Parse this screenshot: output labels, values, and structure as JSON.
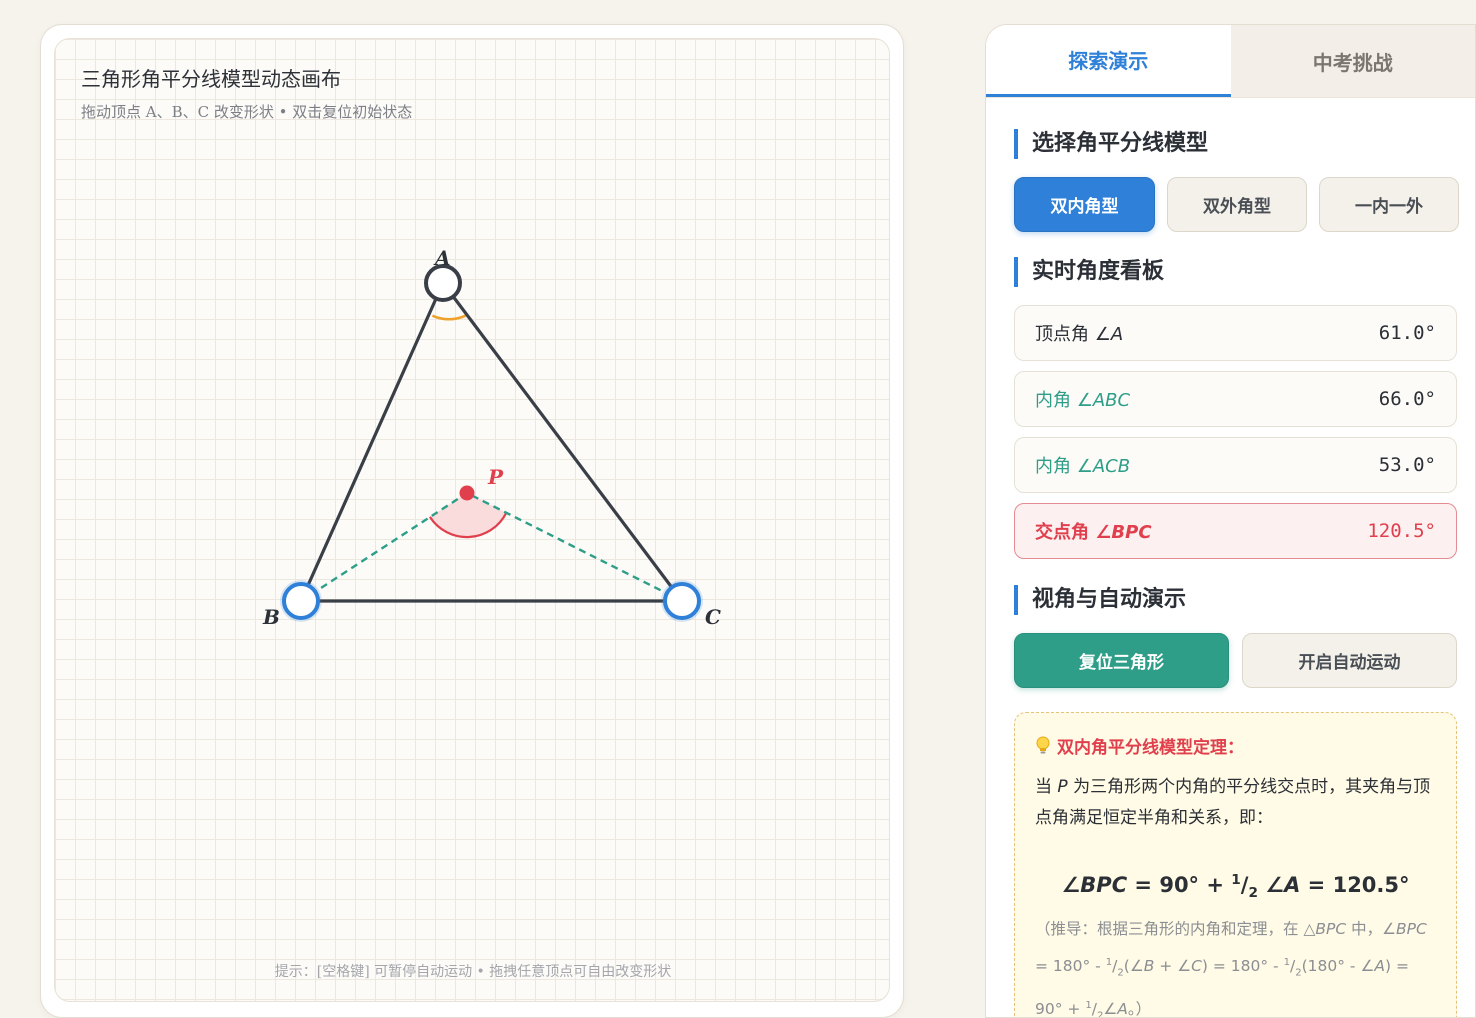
{
  "canvas": {
    "title": "三角形角平分线模型动态画布",
    "subtitle": "拖动顶点 A、B、C 改变形状 • 双击复位初始状态",
    "hint": "提示：[空格键] 可暂停自动运动 • 拖拽任意顶点可自由改变形状",
    "labels": {
      "A": "A",
      "B": "B",
      "C": "C",
      "P": "P"
    }
  },
  "tabs": {
    "explore": "探索演示",
    "challenge": "中考挑战"
  },
  "model_section": {
    "title": "选择角平分线模型",
    "options": [
      "双内角型",
      "双外角型",
      "一内一外"
    ],
    "selected": "双内角型"
  },
  "angle_section": {
    "title": "实时角度看板",
    "rows": [
      {
        "label": "顶点角",
        "math": "∠A",
        "value": "61.0°"
      },
      {
        "label": "内角",
        "math": "∠ABC",
        "value": "66.0°"
      },
      {
        "label": "内角",
        "math": "∠ACB",
        "value": "53.0°"
      },
      {
        "label": "交点角",
        "math": "∠BPC",
        "value": "120.5°"
      }
    ]
  },
  "view_section": {
    "title": "视角与自动演示",
    "reset_button": "复位三角形",
    "auto_button": "开启自动运动"
  },
  "theorem": {
    "heading": "双内角平分线模型定理：",
    "body_pre": "当 ",
    "body_var": "P",
    "body_post": " 为三角形两个内角的平分线交点时，其夹角与顶点角满足恒定半角和关系，即：",
    "formula_result": "120.5°"
  },
  "colors": {
    "accent": "#2f80d8",
    "teal": "#2e9e88",
    "red": "#e0404d",
    "vertexA": "#3a3f47",
    "orange": "#f0a12b"
  },
  "icons": {
    "theorem": "lightbulb-icon"
  }
}
